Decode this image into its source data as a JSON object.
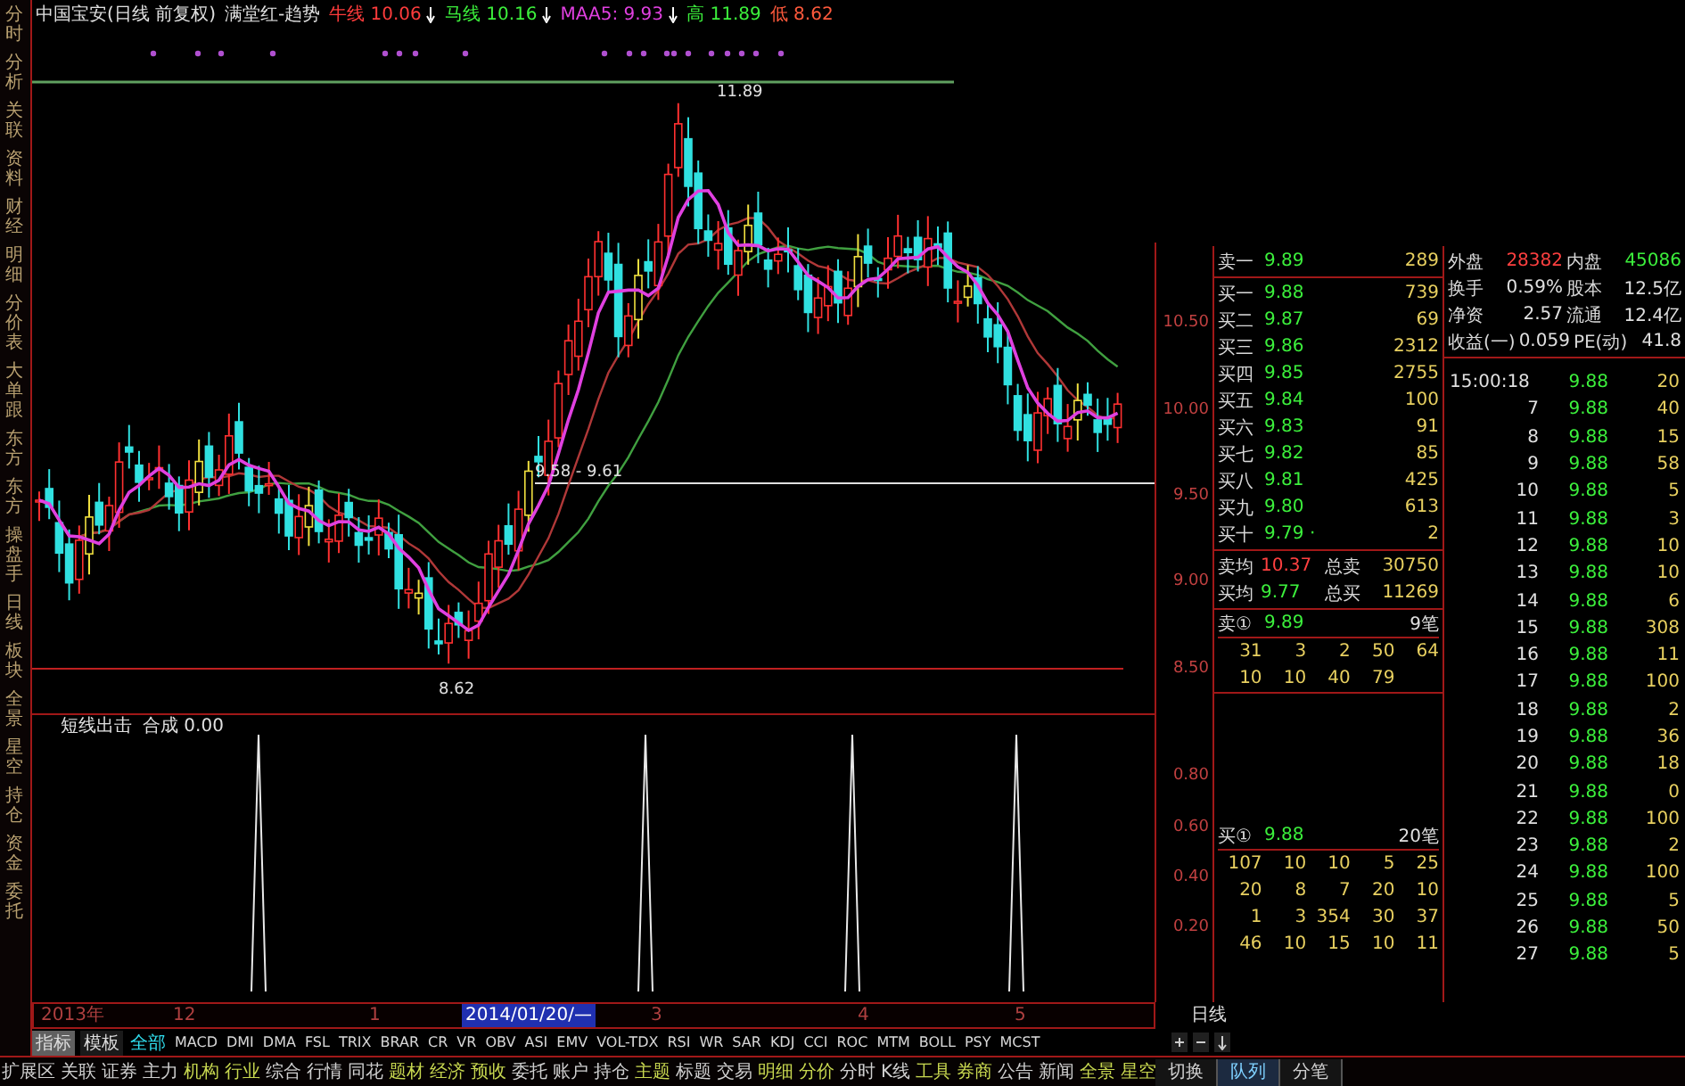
{
  "side_tabs": [
    "分时",
    "分析",
    "关联",
    "资料",
    "财经",
    "明细",
    "分价表",
    "大单跟",
    "东方",
    "东方",
    "操盘手",
    "日线",
    "板块",
    "全景",
    "星空",
    "持仓",
    "资金",
    "委托"
  ],
  "title": {
    "stock": "中国宝安(日线 前复权)",
    "indicator": "满堂红-趋势",
    "legends": [
      {
        "label": "牛线",
        "value": "10.06",
        "color": "#ff3c3c",
        "falling": true
      },
      {
        "label": "马线",
        "value": "10.16",
        "color": "#3cf03c",
        "falling": true
      },
      {
        "label": "MAA5:",
        "value": "9.93",
        "color": "#e040e0",
        "falling": true
      },
      {
        "label": "高",
        "value": "11.89",
        "color": "#3cf03c",
        "falling": false
      },
      {
        "label": "低",
        "value": "8.62",
        "color": "#ff5a3c",
        "falling": false
      }
    ]
  },
  "price_pane": {
    "axis_labels": [
      "10.50",
      "10.00",
      "9.50",
      "9.00",
      "8.50"
    ],
    "annotations": [
      "11.89",
      "9.58 - 9.61",
      "8.62"
    ]
  },
  "indicator_pane": {
    "name": "短线出击",
    "value_label": "合成 0.00",
    "axis_labels": [
      "0.80",
      "0.60",
      "0.40",
      "0.20"
    ]
  },
  "date_axis": [
    {
      "label": "2013年",
      "selected": false
    },
    {
      "label": "12",
      "selected": false
    },
    {
      "label": "1",
      "selected": false
    },
    {
      "label": "2014/01/20/—",
      "selected": true
    },
    {
      "label": "3",
      "selected": false
    },
    {
      "label": "4",
      "selected": false
    },
    {
      "label": "5",
      "selected": false
    }
  ],
  "period_label": "日线",
  "indicator_toolbar": {
    "tabs": [
      {
        "label": "指标",
        "selected": true
      },
      {
        "label": "模板",
        "selected": false
      }
    ],
    "items": [
      {
        "label": "全部",
        "selected": true
      },
      {
        "label": "MACD",
        "selected": false
      },
      {
        "label": "DMI",
        "selected": false
      },
      {
        "label": "DMA",
        "selected": false
      },
      {
        "label": "FSL",
        "selected": false
      },
      {
        "label": "TRIX",
        "selected": false
      },
      {
        "label": "BRAR",
        "selected": false
      },
      {
        "label": "CR",
        "selected": false
      },
      {
        "label": "VR",
        "selected": false
      },
      {
        "label": "OBV",
        "selected": false
      },
      {
        "label": "ASI",
        "selected": false
      },
      {
        "label": "EMV",
        "selected": false
      },
      {
        "label": "VOL-TDX",
        "selected": false
      },
      {
        "label": "RSI",
        "selected": false
      },
      {
        "label": "WR",
        "selected": false
      },
      {
        "label": "SAR",
        "selected": false
      },
      {
        "label": "KDJ",
        "selected": false
      },
      {
        "label": "CCI",
        "selected": false
      },
      {
        "label": "ROC",
        "selected": false
      },
      {
        "label": "MTM",
        "selected": false
      },
      {
        "label": "BOLL",
        "selected": false
      },
      {
        "label": "PSY",
        "selected": false
      },
      {
        "label": "MCST",
        "selected": false
      }
    ]
  },
  "bottom_toolbar": [
    {
      "label": "扩展区",
      "highlighted": false
    },
    {
      "label": "关联",
      "highlighted": false
    },
    {
      "label": "证券",
      "highlighted": false
    },
    {
      "label": "主力",
      "highlighted": false
    },
    {
      "label": "机构",
      "highlighted": true
    },
    {
      "label": "行业",
      "highlighted": true
    },
    {
      "label": "综合",
      "highlighted": false
    },
    {
      "label": "行情",
      "highlighted": false
    },
    {
      "label": "同花",
      "highlighted": false
    },
    {
      "label": "题材",
      "highlighted": true
    },
    {
      "label": "经济",
      "highlighted": true
    },
    {
      "label": "预收",
      "highlighted": true
    },
    {
      "label": "委托",
      "highlighted": false
    },
    {
      "label": "账户",
      "highlighted": false
    },
    {
      "label": "持仓",
      "highlighted": false
    },
    {
      "label": "主题",
      "highlighted": true
    },
    {
      "label": "标题",
      "highlighted": false
    },
    {
      "label": "交易",
      "highlighted": false
    },
    {
      "label": "明细",
      "highlighted": true
    },
    {
      "label": "分价",
      "highlighted": true
    },
    {
      "label": "分时",
      "highlighted": false
    },
    {
      "label": "K线",
      "highlighted": false
    },
    {
      "label": "工具",
      "highlighted": true
    },
    {
      "label": "券商",
      "highlighted": true
    },
    {
      "label": "公告",
      "highlighted": false
    },
    {
      "label": "新闻",
      "highlighted": false
    },
    {
      "label": "全景",
      "highlighted": true
    },
    {
      "label": "星空",
      "highlighted": true
    }
  ],
  "panel_tabs": [
    {
      "label": "切换",
      "selected": false
    },
    {
      "label": "队列",
      "selected": true
    },
    {
      "label": "分笔",
      "selected": false
    }
  ],
  "order_book": {
    "asks": [
      {
        "label": "卖一",
        "price": "9.89",
        "volume": "289"
      }
    ],
    "bids": [
      {
        "label": "买一",
        "price": "9.88",
        "volume": "739"
      },
      {
        "label": "买二",
        "price": "9.87",
        "volume": "69"
      },
      {
        "label": "买三",
        "price": "9.86",
        "volume": "2312"
      },
      {
        "label": "买四",
        "price": "9.85",
        "volume": "2755"
      },
      {
        "label": "买五",
        "price": "9.84",
        "volume": "100"
      },
      {
        "label": "买六",
        "price": "9.83",
        "volume": "91"
      },
      {
        "label": "买七",
        "price": "9.82",
        "volume": "85"
      },
      {
        "label": "买八",
        "price": "9.81",
        "volume": "425"
      },
      {
        "label": "买九",
        "price": "9.80",
        "volume": "613"
      },
      {
        "label": "买十",
        "price": "9.79 ·",
        "volume": "2"
      }
    ],
    "averages": [
      {
        "kind": "sell",
        "label": "卖均",
        "price": "10.37",
        "total_label": "总卖",
        "total": "30750"
      },
      {
        "kind": "buy",
        "label": "买均",
        "price": "9.77",
        "total_label": "总买",
        "total": "11269"
      }
    ]
  },
  "sell_queue": {
    "label": "卖①",
    "price": "9.89",
    "count": "9笔",
    "rows": [
      [
        "31",
        "3",
        "2",
        "50",
        "64"
      ],
      [
        "10",
        "10",
        "40",
        "79"
      ]
    ]
  },
  "buy_queue": {
    "label": "买①",
    "price": "9.88",
    "count": "20笔",
    "rows": [
      [
        "107",
        "10",
        "10",
        "5",
        "25"
      ],
      [
        "20",
        "8",
        "7",
        "20",
        "10"
      ],
      [
        "1",
        "3",
        "354",
        "30",
        "37"
      ],
      [
        "46",
        "10",
        "15",
        "10",
        "11"
      ]
    ]
  },
  "stats": [
    [
      {
        "label": "外盘",
        "value": "28382",
        "kind": "up"
      },
      {
        "label": "内盘",
        "value": "45086",
        "kind": "down"
      }
    ],
    [
      {
        "label": "换手",
        "value": "0.59%",
        "kind": "plain"
      },
      {
        "label": "股本",
        "value": "12.5亿",
        "kind": "plain"
      }
    ],
    [
      {
        "label": "净资",
        "value": "2.57",
        "kind": "plain"
      },
      {
        "label": "流通",
        "value": "12.4亿",
        "kind": "plain"
      }
    ],
    [
      {
        "label": "收益(一)",
        "value": "0.059",
        "kind": "plain"
      },
      {
        "label": "PE(动)",
        "value": "41.8",
        "kind": "plain"
      }
    ]
  ],
  "ticks": [
    {
      "time": "15:00:18",
      "price": "9.88",
      "volume": "20"
    },
    {
      "time": "7",
      "price": "9.88",
      "volume": "40"
    },
    {
      "time": "8",
      "price": "9.88",
      "volume": "15"
    },
    {
      "time": "9",
      "price": "9.88",
      "volume": "58"
    },
    {
      "time": "10",
      "price": "9.88",
      "volume": "5"
    },
    {
      "time": "11",
      "price": "9.88",
      "volume": "3"
    },
    {
      "time": "12",
      "price": "9.88",
      "volume": "10"
    },
    {
      "time": "13",
      "price": "9.88",
      "volume": "10"
    },
    {
      "time": "14",
      "price": "9.88",
      "volume": "6"
    },
    {
      "time": "15",
      "price": "9.88",
      "volume": "308"
    },
    {
      "time": "16",
      "price": "9.88",
      "volume": "11"
    },
    {
      "time": "17",
      "price": "9.88",
      "volume": "100"
    },
    {
      "time": "18",
      "price": "9.88",
      "volume": "2"
    },
    {
      "time": "19",
      "price": "9.88",
      "volume": "36"
    },
    {
      "time": "20",
      "price": "9.88",
      "volume": "18"
    },
    {
      "time": "21",
      "price": "9.88",
      "volume": "0"
    },
    {
      "time": "22",
      "price": "9.88",
      "volume": "100"
    },
    {
      "time": "23",
      "price": "9.88",
      "volume": "2"
    },
    {
      "time": "24",
      "price": "9.88",
      "volume": "100"
    },
    {
      "time": "25",
      "price": "9.88",
      "volume": "5"
    },
    {
      "time": "26",
      "price": "9.88",
      "volume": "50"
    },
    {
      "time": "27",
      "price": "9.88",
      "volume": "5"
    }
  ]
}
